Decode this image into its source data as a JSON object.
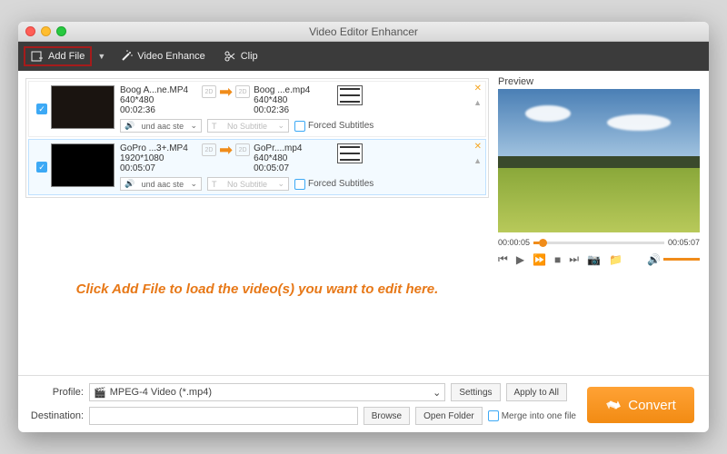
{
  "window": {
    "title": "Video Editor Enhancer"
  },
  "toolbar": {
    "add_file": "Add File",
    "video_enhance": "Video Enhance",
    "clip": "Clip"
  },
  "files": [
    {
      "src": {
        "name": "Boog A...ne.MP4",
        "res": "640*480",
        "dur": "00:02:36"
      },
      "dst": {
        "name": "Boog ...e.mp4",
        "res": "640*480",
        "dur": "00:02:36"
      },
      "audio": "und aac ste",
      "subtitle": "No Subtitle",
      "forced": "Forced Subtitles",
      "badge": "2D"
    },
    {
      "src": {
        "name": "GoPro ...3+.MP4",
        "res": "1920*1080",
        "dur": "00:05:07"
      },
      "dst": {
        "name": "GoPr....mp4",
        "res": "640*480",
        "dur": "00:05:07"
      },
      "audio": "und aac ste",
      "subtitle": "No Subtitle",
      "forced": "Forced Subtitles",
      "badge": "2D"
    }
  ],
  "hint": "Click Add File to load the video(s) you want to edit here.",
  "preview": {
    "label": "Preview",
    "time_current": "00:00:05",
    "time_total": "00:05:07",
    "progress_pct": 4
  },
  "bottom": {
    "profile_label": "Profile:",
    "profile_value": "MPEG-4 Video (*.mp4)",
    "settings": "Settings",
    "apply_all": "Apply to All",
    "destination_label": "Destination:",
    "destination_value": "",
    "browse": "Browse",
    "open_folder": "Open Folder",
    "merge": "Merge into one file",
    "convert": "Convert"
  }
}
